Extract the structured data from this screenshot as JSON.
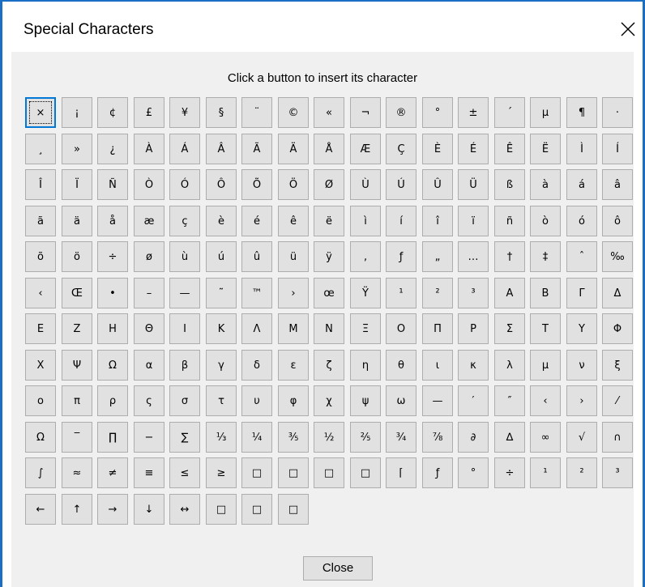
{
  "window": {
    "title": "Special Characters",
    "close_icon": "close-icon"
  },
  "instruction": "Click a button to insert its character",
  "characters": [
    [
      "×",
      "¡",
      "¢",
      "£",
      "¥",
      "§",
      "¨",
      "©",
      "«",
      "¬",
      "®",
      "°",
      "±",
      "´",
      "µ",
      "¶",
      "·"
    ],
    [
      "¸",
      "»",
      "¿",
      "À",
      "Á",
      "Â",
      "Ã",
      "Ä",
      "Å",
      "Æ",
      "Ç",
      "È",
      "É",
      "Ê",
      "Ë",
      "Ì",
      "Í"
    ],
    [
      "Î",
      "Ï",
      "Ñ",
      "Ò",
      "Ó",
      "Ô",
      "Õ",
      "Ö",
      "Ø",
      "Ù",
      "Ú",
      "Û",
      "Ü",
      "ß",
      "à",
      "á",
      "â"
    ],
    [
      "ã",
      "ä",
      "å",
      "æ",
      "ç",
      "è",
      "é",
      "ê",
      "ë",
      "ì",
      "í",
      "î",
      "ï",
      "ñ",
      "ò",
      "ó",
      "ô"
    ],
    [
      "õ",
      "ö",
      "÷",
      "ø",
      "ù",
      "ú",
      "û",
      "ü",
      "ÿ",
      "‚",
      "ƒ",
      "„",
      "…",
      "†",
      "‡",
      "ˆ",
      "‰"
    ],
    [
      "‹",
      "Œ",
      "•",
      "–",
      "—",
      "˜",
      "™",
      "›",
      "œ",
      "Ÿ",
      "¹",
      "²",
      "³",
      "Α",
      "Β",
      "Γ",
      "Δ"
    ],
    [
      "Ε",
      "Ζ",
      "Η",
      "Θ",
      "Ι",
      "Κ",
      "Λ",
      "Μ",
      "Ν",
      "Ξ",
      "Ο",
      "Π",
      "Ρ",
      "Σ",
      "Τ",
      "Υ",
      "Φ"
    ],
    [
      "Χ",
      "Ψ",
      "Ω",
      "α",
      "β",
      "γ",
      "δ",
      "ε",
      "ζ",
      "η",
      "θ",
      "ι",
      "κ",
      "λ",
      "μ",
      "ν",
      "ξ"
    ],
    [
      "ο",
      "π",
      "ρ",
      "ς",
      "σ",
      "τ",
      "υ",
      "φ",
      "χ",
      "ψ",
      "ω",
      "—",
      "′",
      "″",
      "‹",
      "›",
      "⁄"
    ],
    [
      "Ω",
      "‾",
      "∏",
      "−",
      "∑",
      "⅓",
      "¼",
      "⅗",
      "½",
      "⅖",
      "¾",
      "⅞",
      "∂",
      "∆",
      "∞",
      "√",
      "∩"
    ],
    [
      "∫",
      "≈",
      "≠",
      "≡",
      "≤",
      "≥",
      "□",
      "□",
      "□",
      "□",
      "⌈",
      "ƒ",
      "°",
      "÷",
      "¹",
      "²",
      "³"
    ],
    [
      "←",
      "↑",
      "→",
      "↓",
      "↔",
      "□",
      "□",
      "□"
    ]
  ],
  "selected_character": "×",
  "buttons": {
    "close_label": "Close"
  }
}
